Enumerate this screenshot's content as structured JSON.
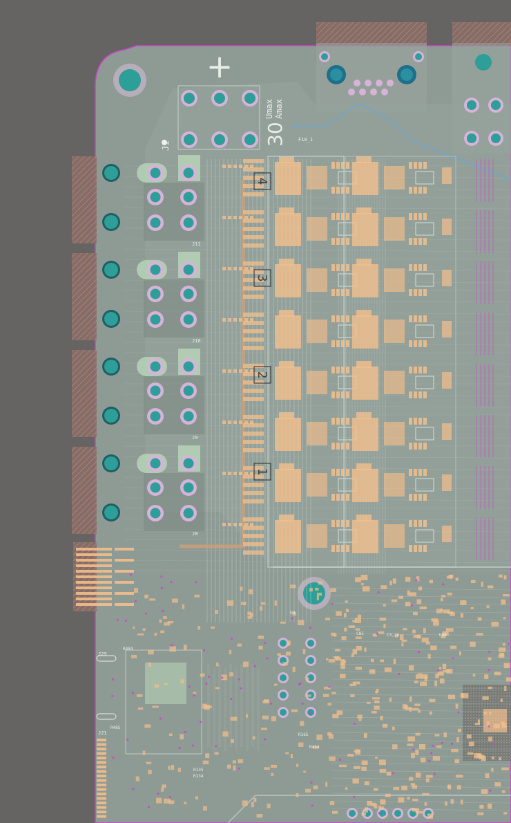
{
  "view": {
    "background_color": "#666463",
    "board_color": "#8e9a94",
    "copper_color": "#f2bf8c",
    "track_color": "#c5d0cc",
    "pad_ring_color": "#d6b3d8",
    "pad_core_color": "#2e9e98",
    "edge_color": "#d040d0",
    "keepout_color": "#b07a6c"
  },
  "silkscreen": {
    "plus_sign": "+",
    "rating_value": "30",
    "rating_units": [
      "Umax",
      "Amax"
    ],
    "channel_numbers": [
      "4",
      "3",
      "2",
      "1"
    ],
    "fuse_label": "F10_1"
  },
  "connectors": [
    {
      "ref": "J1",
      "icon": "screw-terminal-icon"
    },
    {
      "ref": "J11",
      "icon": "screw-terminal-icon"
    },
    {
      "ref": "J10",
      "icon": "screw-terminal-icon"
    },
    {
      "ref": "J9",
      "icon": "screw-terminal-icon"
    },
    {
      "ref": "J8",
      "icon": "screw-terminal-icon"
    },
    {
      "ref": "J29",
      "icon": "header-icon"
    },
    {
      "ref": "J21",
      "icon": "header-icon"
    }
  ],
  "components": {
    "resistors": [
      "R484",
      "R485",
      "R165",
      "R135",
      "R134",
      "R414"
    ],
    "capacitors": [
      "C3,26",
      "C85"
    ],
    "ics": [
      "U80",
      "U9"
    ]
  },
  "mounting_holes": 2
}
